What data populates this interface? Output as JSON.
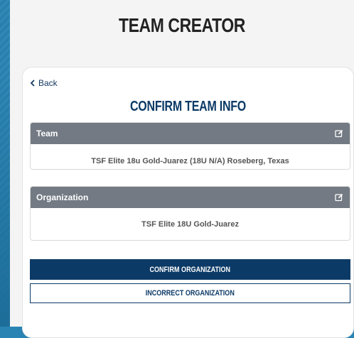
{
  "app": {
    "title": "TEAM CREATOR"
  },
  "card": {
    "back_label": "Back",
    "heading": "CONFIRM TEAM INFO",
    "team_panel": {
      "label": "Team",
      "value": "TSF Elite 18u Gold-Juarez (18U N/A) Roseberg, Texas"
    },
    "organization_panel": {
      "label": "Organization",
      "value": "TSF Elite 18U Gold-Juarez"
    },
    "confirm_label": "CONFIRM ORGANIZATION",
    "incorrect_label": "INCORRECT ORGANIZATION"
  },
  "icons": {
    "back": "chevron-left-icon",
    "edit": "edit-icon"
  },
  "colors": {
    "navy": "#0c3a66",
    "panel_header": "#737a83",
    "background": "#2a84b3"
  }
}
